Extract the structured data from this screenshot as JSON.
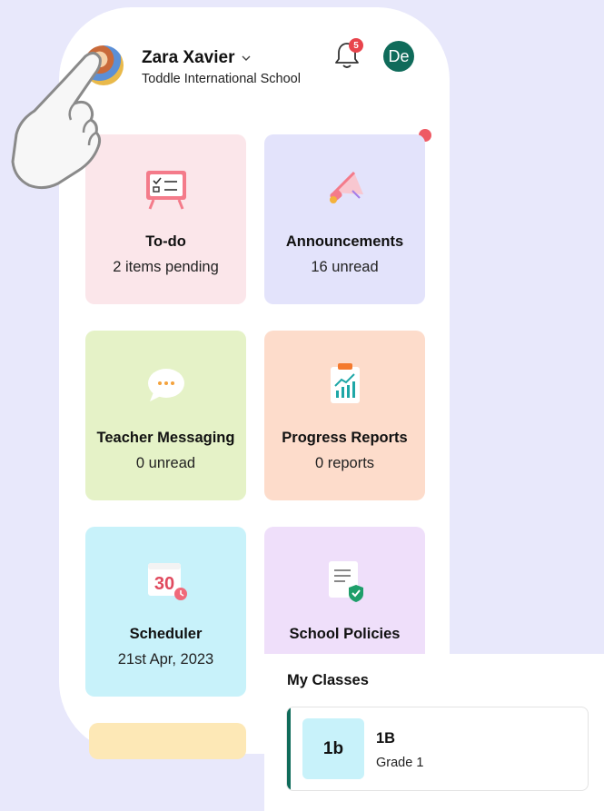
{
  "header": {
    "user_name": "Zara Xavier",
    "school_name": "Toddle International School",
    "notification_count": "5",
    "user_initials": "De"
  },
  "tiles": [
    {
      "title": "To-do",
      "subtitle": "2 items pending",
      "icon": "todo-board-icon"
    },
    {
      "title": "Announcements",
      "subtitle": "16 unread",
      "icon": "megaphone-icon"
    },
    {
      "title": "Teacher Messaging",
      "subtitle": "0 unread",
      "icon": "chat-bubble-icon"
    },
    {
      "title": "Progress Reports",
      "subtitle": "0 reports",
      "icon": "report-chart-icon"
    },
    {
      "title": "Scheduler",
      "subtitle": "21st Apr, 2023",
      "icon": "calendar-icon"
    },
    {
      "title": "School Policies",
      "subtitle": "",
      "icon": "policy-document-icon"
    }
  ],
  "calendar_icon_day": "30",
  "my_classes": {
    "title": "My Classes",
    "classes": [
      {
        "thumb": "1b",
        "name": "1B",
        "grade": "Grade 1"
      }
    ]
  },
  "colors": {
    "background": "#e8e8fb",
    "accent": "#0f6b5a",
    "badge": "#e8444c"
  }
}
